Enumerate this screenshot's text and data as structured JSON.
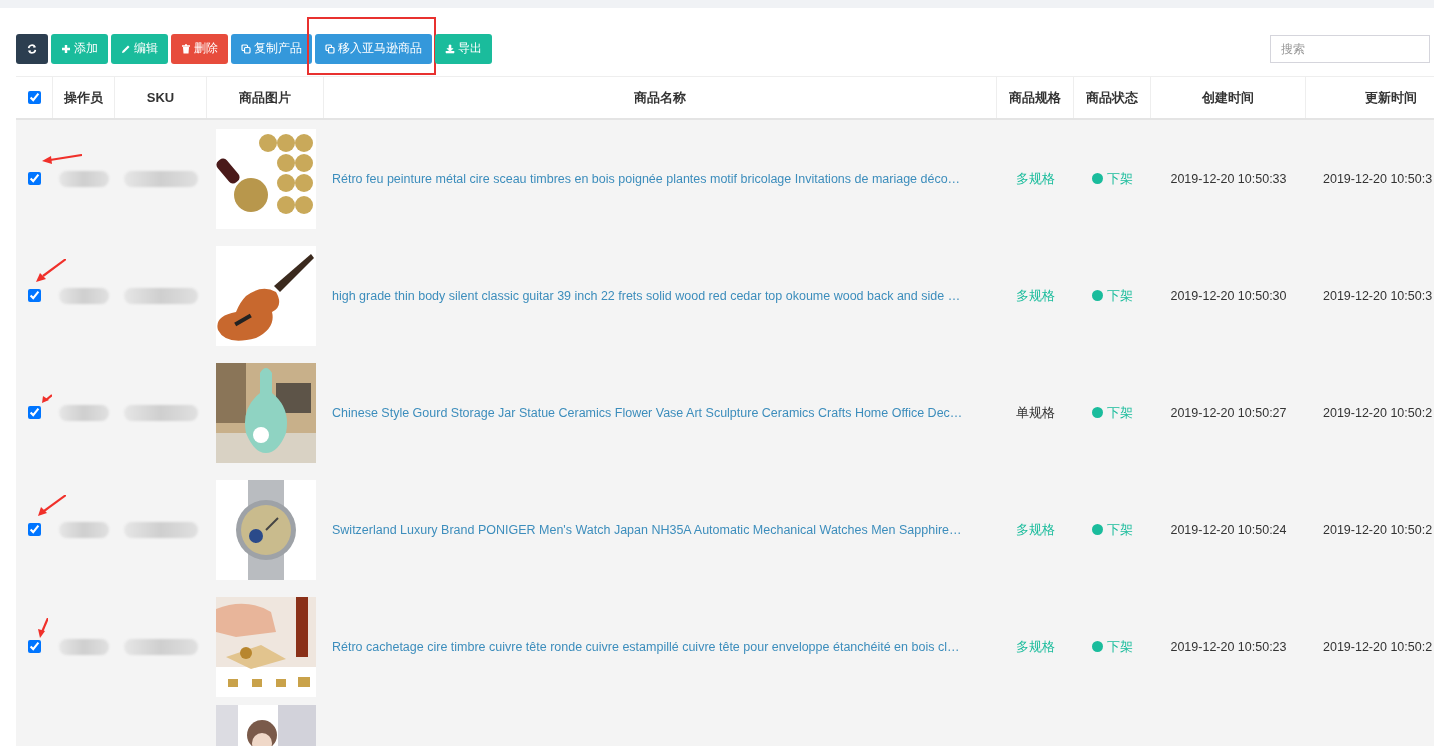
{
  "toolbar": {
    "buttons": [
      {
        "kind": "refresh"
      },
      {
        "kind": "add",
        "label": "添加"
      },
      {
        "kind": "edit",
        "label": "编辑"
      },
      {
        "kind": "delete",
        "label": "删除"
      },
      {
        "kind": "copy",
        "label": "复制产品"
      },
      {
        "kind": "move",
        "label": "移入亚马逊商品",
        "highlighted": true
      },
      {
        "kind": "export",
        "label": "导出"
      }
    ]
  },
  "search": {
    "placeholder": "搜索"
  },
  "table": {
    "all_checked": true,
    "columns": [
      "操作员",
      "SKU",
      "商品图片",
      "商品名称",
      "商品规格",
      "商品状态",
      "创建时间",
      "更新时间"
    ],
    "rows": [
      {
        "checked": true,
        "name": "Rétro feu peinture métal cire sceau timbres en bois poignée plantes motif bricolage Invitations de mariage déco…",
        "spec": "多规格",
        "multi_spec": true,
        "status": "下架",
        "color": "#1abc9c",
        "created": "2019-12-20 10:50:33",
        "updated": "2019-12-20 10:50:3"
      },
      {
        "checked": true,
        "name": "high grade thin body silent classic guitar 39 inch 22 frets solid wood red cedar top okoume wood back and side …",
        "spec": "多规格",
        "multi_spec": true,
        "status": "下架",
        "color": "#1abc9c",
        "created": "2019-12-20 10:50:30",
        "updated": "2019-12-20 10:50:3"
      },
      {
        "checked": true,
        "name": "Chinese Style Gourd Storage Jar Statue Ceramics Flower Vase Art Sculpture Ceramics Crafts Home Office Dec…",
        "spec": "单规格",
        "multi_spec": false,
        "status": "下架",
        "color": "#1abc9c",
        "created": "2019-12-20 10:50:27",
        "updated": "2019-12-20 10:50:2"
      },
      {
        "checked": true,
        "name": "Switzerland Luxury Brand PONIGER Men's Watch Japan NH35A Automatic Mechanical Watches Men Sapphire…",
        "spec": "多规格",
        "multi_spec": true,
        "status": "下架",
        "color": "#1abc9c",
        "created": "2019-12-20 10:50:24",
        "updated": "2019-12-20 10:50:2"
      },
      {
        "checked": true,
        "name": "Rétro cachetage cire timbre cuivre tête ronde cuivre estampillé cuivre tête pour enveloppe étanchéité en bois cl…",
        "spec": "多规格",
        "multi_spec": true,
        "status": "下架",
        "color": "#1abc9c",
        "created": "2019-12-20 10:50:23",
        "updated": "2019-12-20 10:50:2"
      }
    ]
  }
}
